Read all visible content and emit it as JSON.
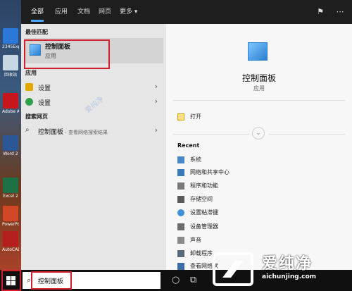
{
  "desktop": {
    "icons": [
      {
        "label": "2345Expl",
        "color": "#2b78d8"
      },
      {
        "label": "回收站",
        "color": "#c8d7e6"
      },
      {
        "label": "Adobe Acrobat",
        "color": "#c8161d"
      },
      {
        "label": "Word 2",
        "color": "#2b5797"
      },
      {
        "label": "Excel 2",
        "color": "#1e7145"
      },
      {
        "label": "PowerPoint",
        "color": "#d24726"
      },
      {
        "label": "AutoCAD 2014",
        "color": "#b51e1e"
      }
    ]
  },
  "tabs": [
    {
      "label": "全部",
      "active": true
    },
    {
      "label": "应用",
      "active": false
    },
    {
      "label": "文档",
      "active": false
    },
    {
      "label": "网页",
      "active": false
    },
    {
      "label": "更多 ▾",
      "active": false
    }
  ],
  "top_icons": [
    "feedback-icon",
    "more-options-icon"
  ],
  "left": {
    "best_match_heading": "最佳匹配",
    "best_match": {
      "title": "控制面板",
      "subtitle": "应用",
      "icon": "control-panel-icon"
    },
    "apps_heading": "应用",
    "apps": [
      {
        "label": "设置",
        "icon": "settings-icon",
        "color": "#e0a800"
      },
      {
        "label": "设置",
        "icon": "settings-icon",
        "color": "#2ea04a"
      }
    ],
    "web_heading": "搜索网页",
    "web_item": {
      "label": "控制面板",
      "hint": " - 查看网络搜索结果",
      "icon": "search-icon"
    }
  },
  "right": {
    "title": "控制面板",
    "subtitle": "应用",
    "open_label": "打开",
    "recent_heading": "Recent",
    "recent": [
      {
        "label": "系统",
        "icon": "system-icon"
      },
      {
        "label": "网络和共享中心",
        "icon": "network-icon"
      },
      {
        "label": "程序和功能",
        "icon": "programs-icon"
      },
      {
        "label": "存储空间",
        "icon": "storage-icon"
      },
      {
        "label": "设置粘滞键",
        "icon": "sticky-keys-icon"
      },
      {
        "label": "设备管理器",
        "icon": "device-manager-icon"
      },
      {
        "label": "声音",
        "icon": "sound-icon"
      },
      {
        "label": "卸载程序",
        "icon": "uninstall-icon"
      },
      {
        "label": "查看网络状",
        "icon": "network-status-icon"
      }
    ]
  },
  "taskbar": {
    "search_value": "控制面板"
  },
  "watermark": {
    "brand": "爱纯净",
    "url": "aichunjing.com",
    "faint": "爱纯净"
  },
  "colors": {
    "highlight": "#d0202a",
    "accent": "#4aa3ff"
  }
}
